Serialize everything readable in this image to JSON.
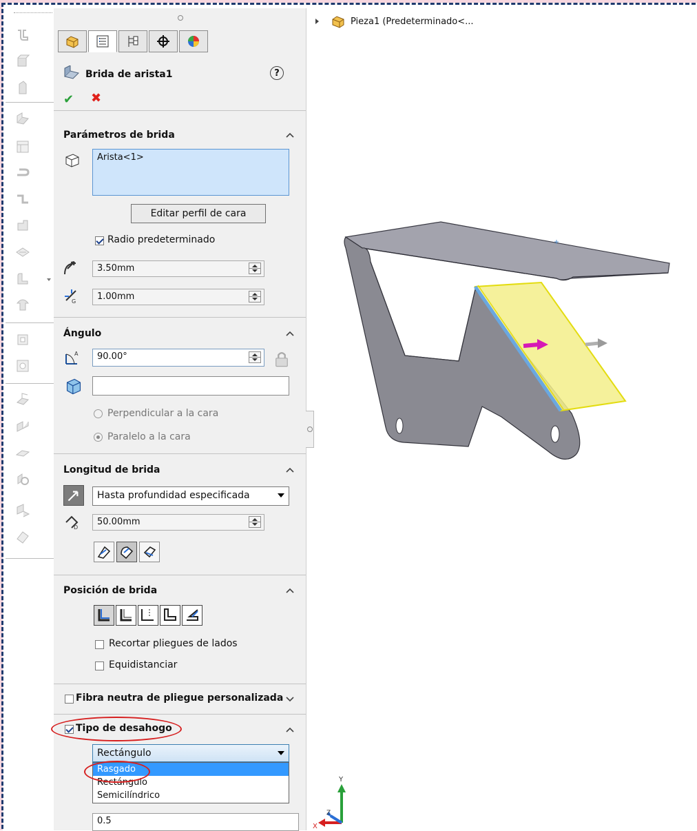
{
  "feature": {
    "title": "Brida de arista1",
    "help_symbol": "?",
    "ok_symbol": "✔",
    "cancel_symbol": "✖"
  },
  "tree": {
    "part_label": "Pieza1  (Predeterminado<..."
  },
  "params": {
    "section_title": "Parámetros de brida",
    "edge_selection": "Arista<1>",
    "edit_profile_button": "Editar perfil de cara",
    "default_radius_label": "Radio predeterminado",
    "default_radius_checked": true,
    "radius_value": "3.50mm",
    "gap_value": "1.00mm"
  },
  "angle": {
    "section_title": "Ángulo",
    "angle_value": "90.00°",
    "reference_face_value": "",
    "perpendicular_label": "Perpendicular a la cara",
    "parallel_label": "Paralelo a la cara"
  },
  "length": {
    "section_title": "Longitud de brida",
    "end_condition": "Hasta profundidad especificada",
    "length_value": "50.00mm"
  },
  "position": {
    "section_title": "Posición de brida",
    "trim_side_bends_label": "Recortar pliegues de lados",
    "offset_label": "Equidistanciar"
  },
  "neutral_fiber": {
    "label": "Fibra neutra de pliegue personalizada"
  },
  "relief": {
    "label": "Tipo de desahogo",
    "checked": true,
    "selected": "Rectángulo",
    "options": [
      "Rasgado",
      "Rectángulo",
      "Semicilíndrico"
    ],
    "highlighted_option": "Rasgado",
    "ratio_value": "0.5"
  },
  "axes": {
    "x": "X",
    "y": "Y",
    "z": "Z"
  },
  "colors": {
    "accent_blue": "#3399ff",
    "selection_fill": "#cfe5fb",
    "highlight_yellow": "#f3ef8a",
    "annotation_red": "#d62020",
    "part_gray": "#8a8a90"
  }
}
